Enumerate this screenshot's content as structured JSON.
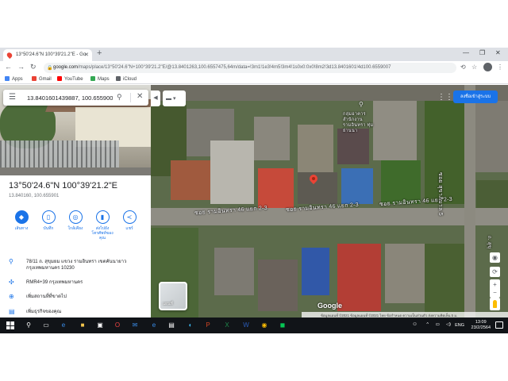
{
  "browser": {
    "tab_title": "13°50'24.6\"N 100°39'21.2\"E - Go",
    "url_domain": "google.com",
    "url_rest": "/maps/place/13°50'24.6\"N+100°39'21.2\"E/@13.8401263,100.6557475,64m/data=!3m1!1e3!4m5!3m4!1s0x0:0x0!8m2!3d13.8401601!4d100.6559007",
    "bookmarks": [
      "Apps",
      "Gmail",
      "YouTube",
      "Maps",
      "iCloud"
    ],
    "bookmark_colors": [
      "#4285f4",
      "#ea4335",
      "#ff0000",
      "#34a853",
      "#5f6368"
    ]
  },
  "panel": {
    "search_value": "13.8401601439887, 100.6559007",
    "coords_title": "13°50'24.6\"N 100°39'21.2\"E",
    "coords_decimal": "13.840160, 100.655901",
    "actions": [
      "เส้นทาง",
      "บันทึก",
      "ใกล้เคียง",
      "ส่งไปยังโทรศัพท์ของคุณ",
      "แชร์"
    ],
    "address": "78/11 ถ. สุขุมยม แขวง รามอินทรา เขตคันนายาว กรุงเทพมหานคร 10230",
    "plus_code": "RMR4+39 กรุงเทพมหานคร",
    "add_missing_place": "เพิ่มสถานที่ที่ขาดไป",
    "add_business": "เพิ่มธุรกิจของคุณ"
  },
  "map": {
    "poi_label": "กลุ่มอาคารสำนักงาน รามอินทรา ทุ่มย่านนา",
    "road_labels": [
      "ซอย รามอินทรา 46 แยก 2-3",
      "ซอย รามอินทรา 46 แยก 2-3",
      "ซอย รามอินทรา 46 แยก 2-3",
      "ซอย สุขาภิบาล 5"
    ],
    "right_label": "ถ. สุขุ",
    "signin_label": "ลงชื่อเข้าสู่ระบบ",
    "layers_label": "แผนที่",
    "logo": "Google",
    "attribution": "ข้อมูลแผนที่ ©2021  ข้อมูลแผนที่ ©2021   ไทย   ข้อกำหนด   ความเป็นส่วนตัว   ส่งความคิดเห็น   5 ม."
  },
  "taskbar": {
    "lang": "ENG",
    "time": "13:09",
    "date": "23/2/2564"
  },
  "colors": {
    "accent": "#1a73e8",
    "pin": "#ea4335",
    "taskbar": "#111418"
  }
}
